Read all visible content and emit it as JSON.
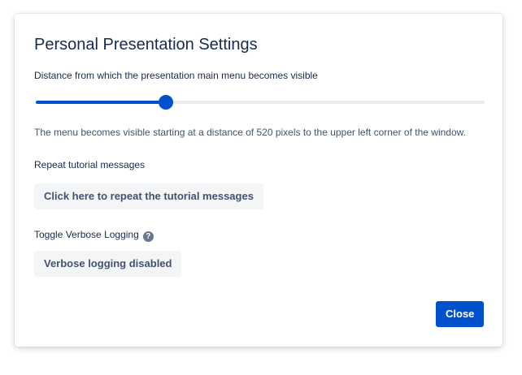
{
  "dialog": {
    "title": "Personal Presentation Settings",
    "close_label": "Close"
  },
  "distance": {
    "label": "Distance from which the presentation main menu becomes visible",
    "slider_fraction": 0.29,
    "help_text": "The menu becomes visible starting at a distance of 520 pixels to the upper left corner of the window."
  },
  "tutorial": {
    "label": "Repeat tutorial messages",
    "button_label": "Click here to repeat the tutorial messages"
  },
  "logging": {
    "label": "Toggle Verbose Logging",
    "help_icon": "?",
    "button_label": "Verbose logging disabled"
  },
  "colors": {
    "accent": "#0052cc",
    "text": "#172b4d",
    "subtle_text": "#42526e",
    "button_bg": "#f4f5f7"
  }
}
